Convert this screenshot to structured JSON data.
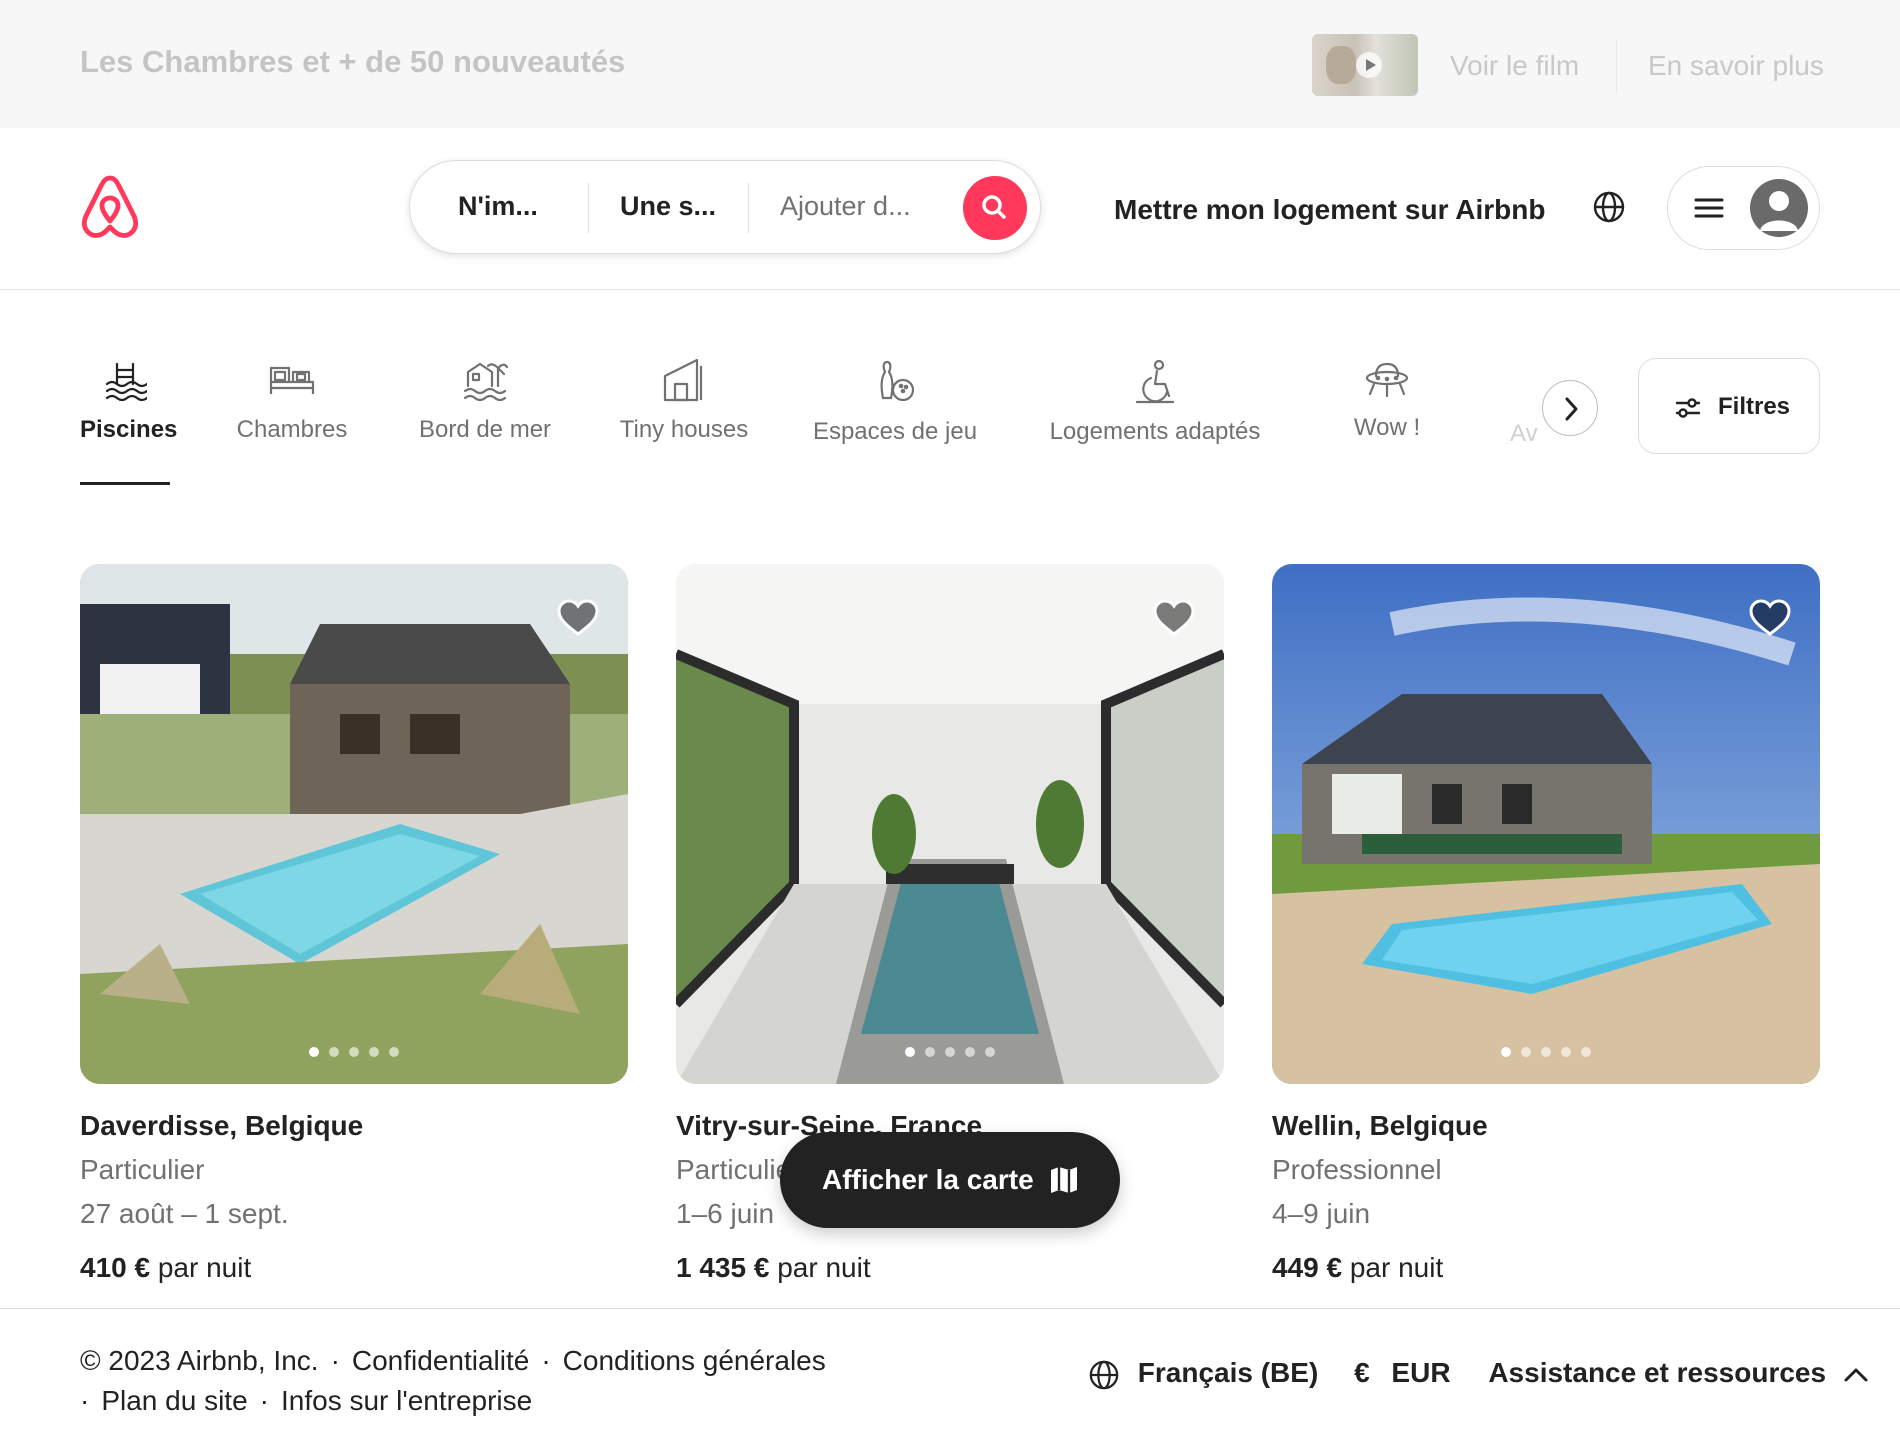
{
  "promo": {
    "title": "Les Chambres et + de 50 nouveautés",
    "watch_label": "Voir le film",
    "learn_label": "En savoir plus"
  },
  "header": {
    "search": {
      "where": "N'im...",
      "when": "Une s...",
      "who": "Ajouter d..."
    },
    "host_label": "Mettre mon logement sur Airbnb",
    "brand_color": "#FF385C"
  },
  "categories": {
    "items": [
      {
        "label": "Piscines",
        "icon": "pool-icon",
        "active": true
      },
      {
        "label": "Chambres",
        "icon": "bed-icon"
      },
      {
        "label": "Bord de mer",
        "icon": "beachfront-icon"
      },
      {
        "label": "Tiny houses",
        "icon": "tiny-house-icon"
      },
      {
        "label": "Espaces de jeu",
        "icon": "bowling-icon"
      },
      {
        "label": "Logements adaptés",
        "icon": "accessible-icon"
      },
      {
        "label": "Wow !",
        "icon": "ufo-icon"
      }
    ],
    "faded_next": "Av",
    "filters_label": "Filtres"
  },
  "listings": [
    {
      "location": "Daverdisse, Belgique",
      "host_type": "Particulier",
      "dates": "27 août – 1 sept.",
      "price": "410 €",
      "price_suffix": "par nuit"
    },
    {
      "location": "Vitry-sur-Seine, France",
      "host_type": "Particulier",
      "dates": "1–6 juin",
      "price": "1 435 €",
      "price_suffix": "par nuit"
    },
    {
      "location": "Wellin, Belgique",
      "host_type": "Professionnel",
      "dates": "4–9 juin",
      "price": "449 €",
      "price_suffix": "par nuit"
    }
  ],
  "map_button_label": "Afficher la carte",
  "footer": {
    "copyright": "© 2023 Airbnb, Inc.",
    "links": [
      "Confidentialité",
      "Conditions générales",
      "Plan du site",
      "Infos sur l'entreprise"
    ],
    "language": "Français (BE)",
    "currency_symbol": "€",
    "currency": "EUR",
    "support": "Assistance et ressources"
  }
}
